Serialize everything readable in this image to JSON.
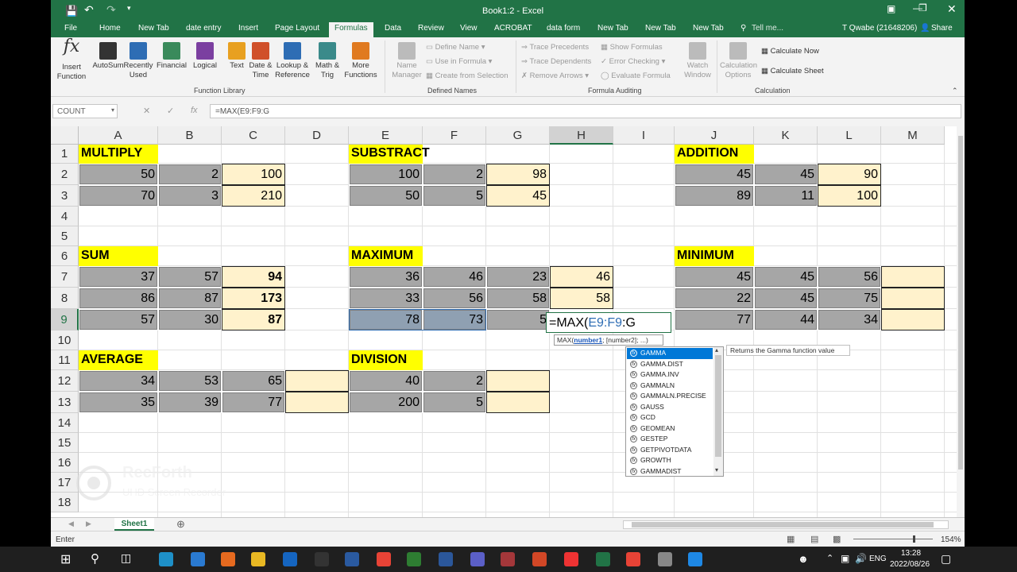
{
  "window": {
    "title": "Book1:2 - Excel",
    "user": "T Qwabe (21648206)",
    "share": "Share",
    "tell_me": "Tell me..."
  },
  "menu": [
    "File",
    "Home",
    "New Tab",
    "date entry",
    "Insert",
    "Page Layout",
    "Formulas",
    "Data",
    "Review",
    "View",
    "ACROBAT",
    "data form",
    "New Tab",
    "New Tab",
    "New Tab"
  ],
  "ribbon": {
    "insert_function": "Insert\nFunction",
    "library_buttons": [
      {
        "label": "AutoSum",
        "icon": "sigma-icon",
        "color": "#333333"
      },
      {
        "label": "Recently\nUsed",
        "icon": "star-icon",
        "color": "#2e6db4"
      },
      {
        "label": "Financial",
        "icon": "book-icon",
        "color": "#3a8a5b"
      },
      {
        "label": "Logical",
        "icon": "question-book-icon",
        "color": "#7b3fa0"
      },
      {
        "label": "Text",
        "icon": "text-book-icon",
        "color": "#e8a020"
      },
      {
        "label": "Date &\nTime",
        "icon": "calendar-icon",
        "color": "#d0502a"
      },
      {
        "label": "Lookup &\nReference",
        "icon": "magnifier-book-icon",
        "color": "#2e6db4"
      },
      {
        "label": "Math &\nTrig",
        "icon": "theta-book-icon",
        "color": "#3a8a8a"
      },
      {
        "label": "More\nFunctions",
        "icon": "more-book-icon",
        "color": "#e07a20"
      }
    ],
    "function_library": "Function Library",
    "name_manager": "Name\nManager",
    "define_name": "Define Name",
    "use_in_formula": "Use in Formula",
    "create_from_selection": "Create from Selection",
    "defined_names": "Defined Names",
    "trace_precedents": "Trace Precedents",
    "trace_dependents": "Trace Dependents",
    "remove_arrows": "Remove Arrows",
    "show_formulas": "Show Formulas",
    "error_checking": "Error Checking",
    "evaluate_formula": "Evaluate Formula",
    "watch_window": "Watch\nWindow",
    "formula_auditing": "Formula Auditing",
    "calculation_options": "Calculation\nOptions",
    "calculate_now": "Calculate Now",
    "calculate_sheet": "Calculate Sheet",
    "calculation": "Calculation"
  },
  "formula_bar": {
    "name_box": "COUNT",
    "fx": "fx",
    "formula": "=MAX(E9:F9:G"
  },
  "columns": [
    "A",
    "B",
    "C",
    "D",
    "E",
    "F",
    "G",
    "H",
    "I",
    "J",
    "K",
    "L",
    "M"
  ],
  "rows": [
    "1",
    "2",
    "3",
    "4",
    "5",
    "6",
    "7",
    "8",
    "9",
    "10",
    "11",
    "12",
    "13",
    "14",
    "15",
    "16",
    "17",
    "18"
  ],
  "sections": {
    "multiply": {
      "title": "MULTIPLY",
      "rows": [
        [
          "50",
          "2",
          "100"
        ],
        [
          "70",
          "3",
          "210"
        ]
      ]
    },
    "substract": {
      "title": "SUBSTRACT",
      "rows": [
        [
          "100",
          "2",
          "98"
        ],
        [
          "50",
          "5",
          "45"
        ]
      ]
    },
    "addition": {
      "title": "ADDITION",
      "rows": [
        [
          "45",
          "45",
          "90"
        ],
        [
          "89",
          "11",
          "100"
        ]
      ]
    },
    "sum": {
      "title": "SUM",
      "rows": [
        [
          "37",
          "57",
          "94"
        ],
        [
          "86",
          "87",
          "173"
        ],
        [
          "57",
          "30",
          "87"
        ]
      ]
    },
    "maximum": {
      "title": "MAXIMUM",
      "rows": [
        [
          "36",
          "46",
          "23",
          "46"
        ],
        [
          "33",
          "56",
          "58",
          "58"
        ],
        [
          "78",
          "73",
          "5",
          ""
        ]
      ]
    },
    "minimum": {
      "title": "MINIMUM",
      "rows": [
        [
          "45",
          "45",
          "56"
        ],
        [
          "22",
          "45",
          "75"
        ],
        [
          "77",
          "44",
          "34"
        ]
      ]
    },
    "average": {
      "title": "AVERAGE",
      "rows": [
        [
          "34",
          "53",
          "65"
        ],
        [
          "35",
          "39",
          "77"
        ]
      ]
    },
    "division": {
      "title": "DIVISION",
      "rows": [
        [
          "40",
          "2"
        ],
        [
          "200",
          "5"
        ]
      ]
    }
  },
  "editing": {
    "prefix": "=MAX(",
    "ref": "E9:F9",
    "suffix": ":G"
  },
  "hint": {
    "fn": "MAX(",
    "arg1": "number1",
    "rest": "; [number2]; ...)"
  },
  "autocomplete": [
    "GAMMA",
    "GAMMA.DIST",
    "GAMMA.INV",
    "GAMMALN",
    "GAMMALN.PRECISE",
    "GAUSS",
    "GCD",
    "GEOMEAN",
    "GESTEP",
    "GETPIVOTDATA",
    "GROWTH",
    "GAMMADIST"
  ],
  "tooltip": "Returns the Gamma function value",
  "sheet_tab": "Sheet1",
  "status": {
    "mode": "Enter",
    "zoom": "154%"
  },
  "watermark": {
    "title": "RecForth",
    "subtitle": "UHD Screen Recorder"
  },
  "taskbar": {
    "lang": "ENG",
    "time": "13:28",
    "date": "2022/08/26"
  },
  "colors": {
    "excel_green": "#217346",
    "gray_cell": "#a6a6a6",
    "yellow_cell": "#fff2cc",
    "title_yellow": "#ffff00"
  }
}
